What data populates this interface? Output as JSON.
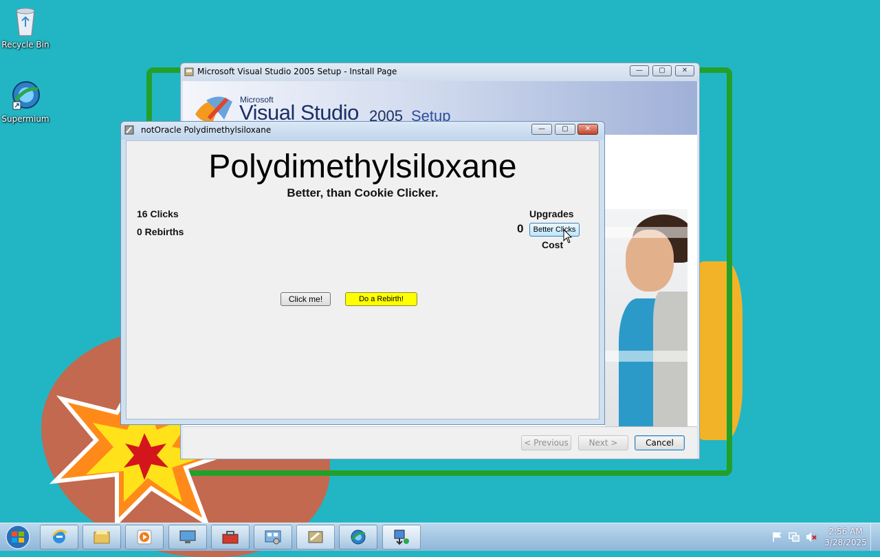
{
  "desktop": {
    "icons": [
      {
        "label": "Recycle Bin",
        "icon": "recycle-bin-icon"
      },
      {
        "label": "Supermium",
        "icon": "supermium-icon"
      }
    ]
  },
  "vs_window": {
    "title": "Microsoft Visual Studio 2005 Setup - Install Page",
    "banner": {
      "brand": "Microsoft",
      "product": "Visual Studio",
      "version": "2005",
      "suffix": "Setup"
    },
    "buttons": {
      "previous": "< Previous",
      "next": "Next >",
      "cancel": "Cancel"
    }
  },
  "app_window": {
    "title": "notOracle Polydimethylsiloxane",
    "heading": "Polydimethylsiloxane",
    "subtitle": "Better, than Cookie Clicker.",
    "clicks": "16 Clicks",
    "rebirths": "0 Rebirths",
    "upgrades_label": "Upgrades",
    "upgrade_count": "0",
    "upgrade_button": "Better Clicks",
    "cost_label": "Cost",
    "click_button": "Click me!",
    "rebirth_button": "Do a Rebirth!",
    "rebirth_color": "#ffff00"
  },
  "taskbar": {
    "pinned": [
      "internet-explorer-icon",
      "file-explorer-icon",
      "media-player-icon",
      "remote-desktop-icon",
      "toolbox-icon",
      "control-panel-icon",
      "setup-icon",
      "supermium-icon",
      "installer-icon"
    ],
    "tray": [
      "flag-icon",
      "network-icon",
      "volume-muted-icon"
    ],
    "time": "2:56 AM",
    "date": "3/28/2025"
  }
}
